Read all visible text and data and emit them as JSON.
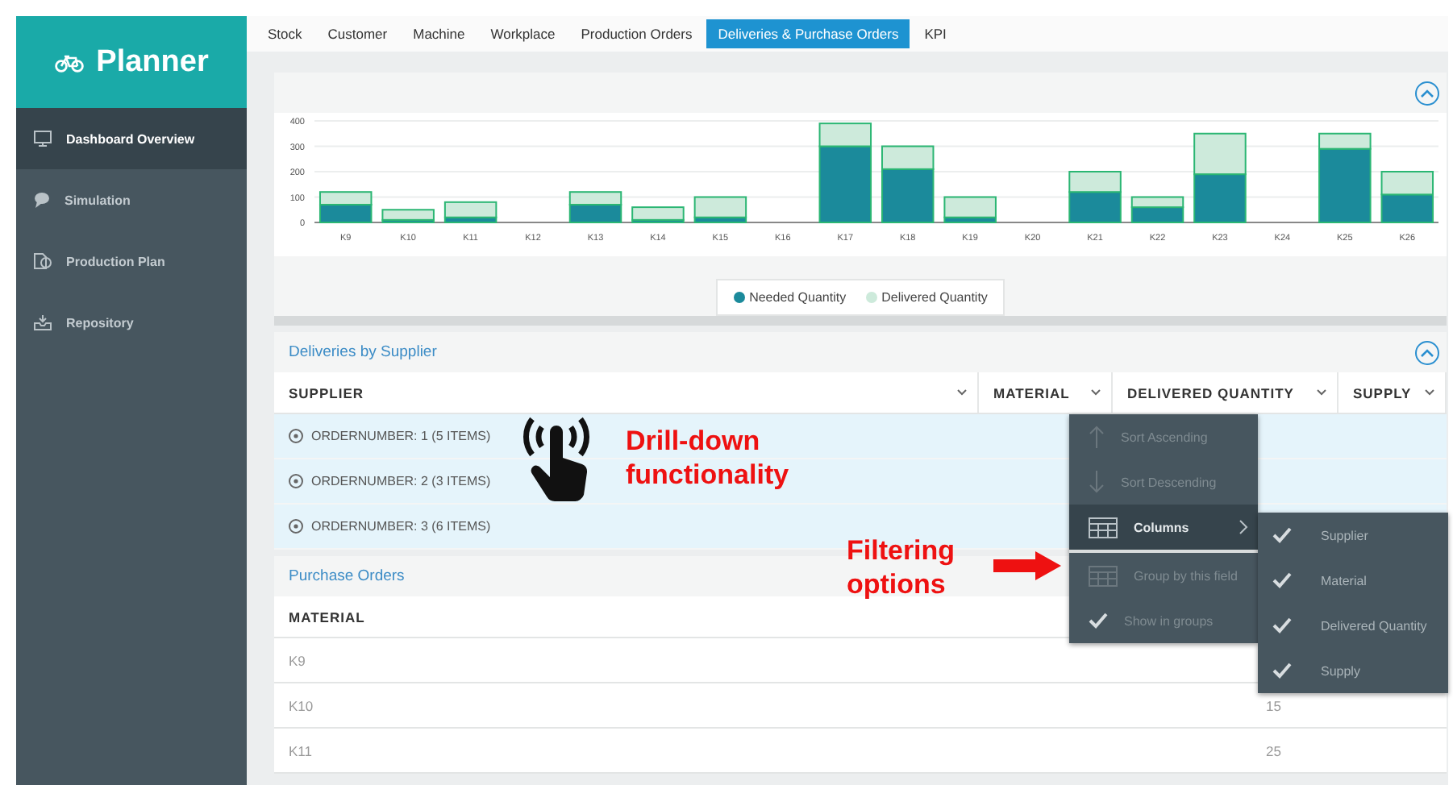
{
  "sidebar": {
    "title": "Planner",
    "items": [
      {
        "label": "Dashboard Overview",
        "selected": true
      },
      {
        "label": "Simulation",
        "selected": false
      },
      {
        "label": "Production Plan",
        "selected": false
      },
      {
        "label": "Repository",
        "selected": false
      }
    ]
  },
  "tabs": [
    {
      "label": "Stock",
      "selected": false
    },
    {
      "label": "Customer",
      "selected": false
    },
    {
      "label": "Machine",
      "selected": false
    },
    {
      "label": "Workplace",
      "selected": false
    },
    {
      "label": "Production Orders",
      "selected": false
    },
    {
      "label": "Deliveries & Purchase Orders",
      "selected": true
    },
    {
      "label": "KPI",
      "selected": false
    }
  ],
  "chart_panel": {
    "chart_data": {
      "type": "bar",
      "stacked": true,
      "grid": true,
      "categories": [
        "K9",
        "K10",
        "K11",
        "K12",
        "K13",
        "K14",
        "K15",
        "K16",
        "K17",
        "K18",
        "K19",
        "K20",
        "K21",
        "K22",
        "K23",
        "K24",
        "K25",
        "K26"
      ],
      "ylim": [
        0,
        400
      ],
      "yticks": [
        0,
        100,
        200,
        300,
        400
      ],
      "series": [
        {
          "name": "Needed Quantity",
          "color": "#1b8a9b",
          "values": [
            70,
            10,
            20,
            0,
            70,
            10,
            20,
            0,
            300,
            210,
            20,
            0,
            120,
            60,
            190,
            0,
            290,
            110
          ]
        },
        {
          "name": "Delivered Quantity",
          "color": "#cdeadb",
          "values": [
            50,
            40,
            60,
            0,
            50,
            50,
            80,
            0,
            90,
            90,
            80,
            0,
            80,
            40,
            160,
            0,
            60,
            90
          ]
        }
      ]
    }
  },
  "deliveries": {
    "title": "Deliveries by Supplier",
    "columns": [
      "SUPPLIER",
      "MATERIAL",
      "DELIVERED QUANTITY",
      "SUPPLY"
    ],
    "groups": [
      "ORDERNUMBER: 1 (5 ITEMS)",
      "ORDERNUMBER: 2 (3 ITEMS)",
      "ORDERNUMBER: 3 (6 ITEMS)"
    ]
  },
  "purchase_orders": {
    "title": "Purchase Orders",
    "columns": [
      "MATERIAL"
    ],
    "rows": [
      {
        "material": "K9"
      },
      {
        "material": "K10",
        "column_2": "15"
      },
      {
        "material": "K11",
        "column_2": "25"
      }
    ]
  },
  "column_menu": {
    "items": [
      {
        "kind": "sort_ascending",
        "label": "Sort Ascending",
        "disabled": true,
        "selected": false
      },
      {
        "kind": "sort_descending",
        "label": "Sort Descending",
        "disabled": true,
        "selected": false
      },
      {
        "kind": "submenu",
        "label": "Columns",
        "disabled": false,
        "selected": true
      },
      {
        "kind": "group",
        "label": "Group by this field",
        "disabled": true,
        "selected": false
      },
      {
        "kind": "toggle",
        "label": "Show in groups",
        "disabled": true,
        "selected": false,
        "checked": true
      }
    ],
    "submenu": [
      {
        "label": "Supplier",
        "checked": true
      },
      {
        "label": "Material",
        "checked": true
      },
      {
        "label": "Delivered Quantity",
        "checked": true
      },
      {
        "label": "Supply",
        "checked": true
      }
    ]
  },
  "annotations": [
    {
      "kind": "drill",
      "text": "Drill-down functionality"
    },
    {
      "kind": "filter",
      "text": "Filtering options"
    }
  ]
}
